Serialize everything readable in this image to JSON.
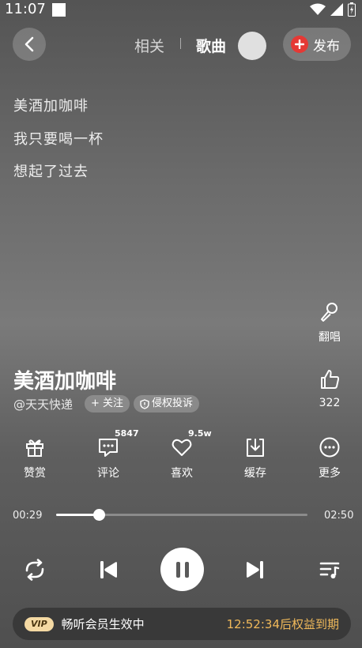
{
  "status": {
    "time": "11:07"
  },
  "header": {
    "tab_related": "相关",
    "tab_songs": "歌曲",
    "publish_label": "发布"
  },
  "lyrics": [
    "美酒加咖啡",
    "我只要喝一杯",
    "想起了过去"
  ],
  "side": {
    "cover_label": "翻唱",
    "like_count": "322"
  },
  "song": {
    "title": "美酒加咖啡",
    "artist": "@天天快递",
    "follow_label": "+ 关注",
    "report_label": "侵权投诉"
  },
  "actions": [
    {
      "label": "赞赏",
      "badge": ""
    },
    {
      "label": "评论",
      "badge": "5847"
    },
    {
      "label": "喜欢",
      "badge": "9.5w"
    },
    {
      "label": "缓存",
      "badge": ""
    },
    {
      "label": "更多",
      "badge": ""
    }
  ],
  "player": {
    "current_time": "00:29",
    "total_time": "02:50",
    "progress": 0.17
  },
  "vip": {
    "badge": "VIP",
    "text": "畅听会员生效中",
    "expiry": "12:52:34后权益到期",
    "accent_color": "#f0b95a"
  }
}
